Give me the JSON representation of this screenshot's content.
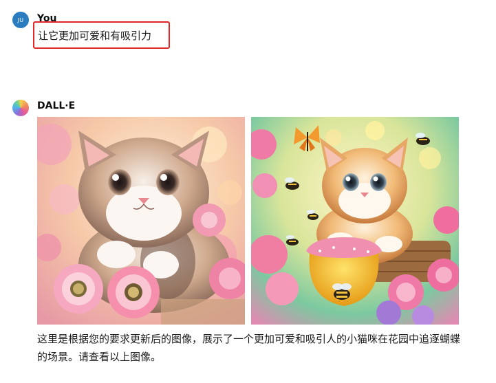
{
  "user_message": {
    "avatar_initials": "JU",
    "sender": "You",
    "text": "让它更加可爱和有吸引力"
  },
  "assistant_message": {
    "sender": "DALL·E",
    "images": [
      {
        "icon": "kitten-with-flowers-image"
      },
      {
        "icon": "kitten-with-honey-and-bees-image"
      }
    ],
    "reply": "这里是根据您的要求更新后的图像，展示了一个更加可爱和吸引人的小猫咪在花园中追逐蝴蝶的场景。请查看以上图像。"
  },
  "colors": {
    "user_avatar": "#2b7bbf",
    "highlight": "#e32626"
  }
}
